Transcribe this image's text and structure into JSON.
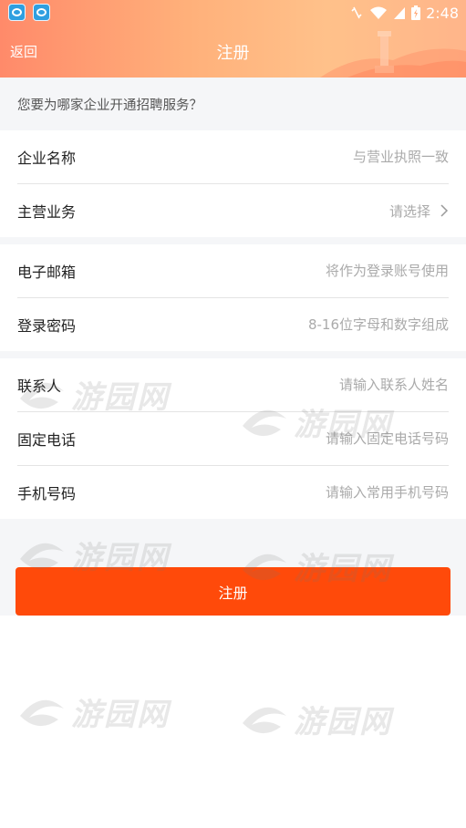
{
  "status_bar": {
    "time": "2:48"
  },
  "nav": {
    "back_label": "返回",
    "title": "注册"
  },
  "question": "您要为哪家企业开通招聘服务？",
  "groups": [
    {
      "rows": [
        {
          "label": "企业名称",
          "placeholder": "与营业执照一致"
        },
        {
          "label": "主营业务",
          "value": "请选择"
        }
      ]
    },
    {
      "rows": [
        {
          "label": "电子邮箱",
          "placeholder": "将作为登录账号使用"
        },
        {
          "label": "登录密码",
          "placeholder": "8-16位字母和数字组成"
        }
      ]
    },
    {
      "rows": [
        {
          "label": "联系人",
          "placeholder": "请输入联系人姓名"
        },
        {
          "label": "固定电话",
          "placeholder": "请输入固定电话号码"
        },
        {
          "label": "手机号码",
          "placeholder": "请输入常用手机号码"
        }
      ]
    }
  ],
  "register_button": "注册",
  "watermark": "游园网",
  "colors": {
    "accent": "#ff4a0a",
    "header_gradient_start": "#ff8a6a",
    "header_gradient_end": "#ffc18a",
    "background_gray": "#f5f6f8"
  }
}
